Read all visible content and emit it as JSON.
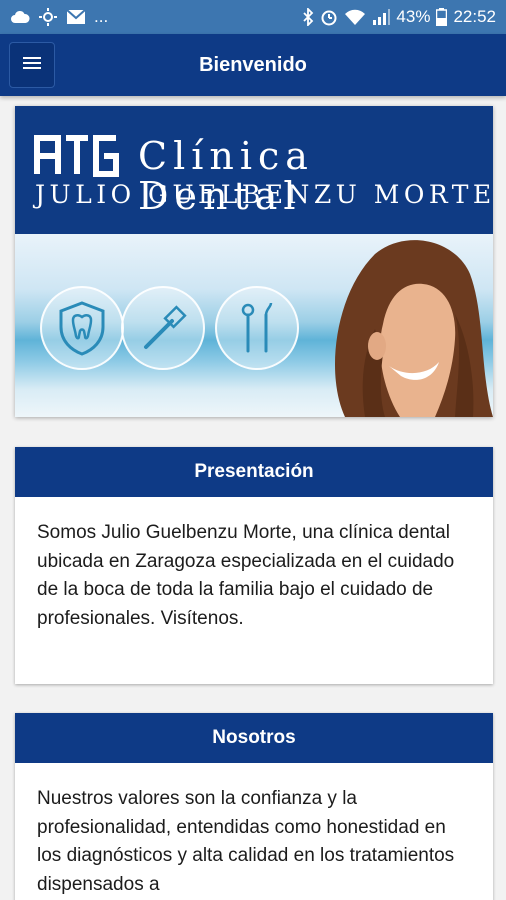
{
  "status_bar": {
    "battery": "43%",
    "time": "22:52",
    "overflow": "..."
  },
  "app_bar": {
    "title": "Bienvenido"
  },
  "banner": {
    "logo_mark": "ATG",
    "brand_line_1": "Clínica Dental",
    "brand_line_2": "JULIO GUELBENZU MORTE",
    "service_icons": [
      "tooth-shield-icon",
      "toothbrush-icon",
      "dental-tools-icon"
    ]
  },
  "sections": [
    {
      "title": "Presentación",
      "body": "Somos Julio Guelbenzu Morte, una clínica dental ubicada en Zaragoza especializada en el cuidado de la boca de toda la familia bajo el cuidado de profesionales. Visítenos."
    },
    {
      "title": "Nosotros",
      "body": "Nuestros valores son la confianza y la profesionalidad, entendidas como honestidad en los diagnósticos y alta calidad en los tratamientos dispensados a"
    }
  ],
  "colors": {
    "status_bar": "#3d76b0",
    "primary": "#0e3a86",
    "background": "#f2f2f2"
  }
}
